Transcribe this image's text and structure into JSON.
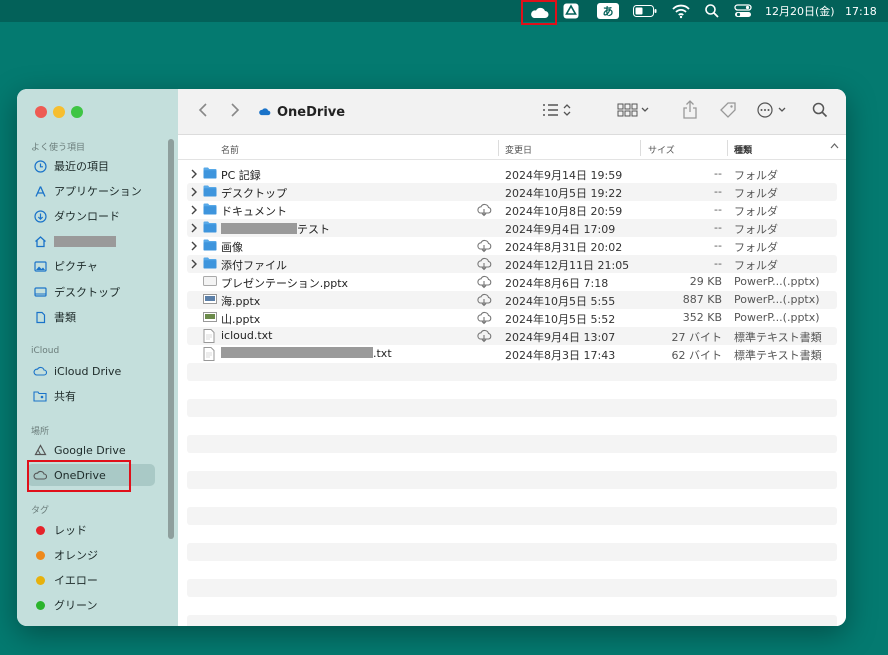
{
  "menubar": {
    "ime_label": "あ",
    "date": "12月20日(金)",
    "time": "17:18"
  },
  "window": {
    "title": "OneDrive",
    "sidebar": {
      "favorites_header": "よく使う項目",
      "favorites": [
        {
          "label": "最近の項目",
          "icon": "clock-icon"
        },
        {
          "label": "アプリケーション",
          "icon": "applications-icon"
        },
        {
          "label": "ダウンロード",
          "icon": "download-icon"
        },
        {
          "label": "",
          "icon": "home-icon",
          "redacted": true
        },
        {
          "label": "ピクチャ",
          "icon": "pictures-icon"
        },
        {
          "label": "デスクトップ",
          "icon": "desktop-icon"
        },
        {
          "label": "書類",
          "icon": "document-icon"
        }
      ],
      "icloud_header": "iCloud",
      "icloud": [
        {
          "label": "iCloud Drive",
          "icon": "icloud-icon"
        },
        {
          "label": "共有",
          "icon": "shared-folder-icon"
        }
      ],
      "locations_header": "場所",
      "locations": [
        {
          "label": "Google Drive",
          "icon": "google-drive-icon"
        },
        {
          "label": "OneDrive",
          "icon": "cloud-icon",
          "selected": true
        }
      ],
      "tags_header": "タグ",
      "tags": [
        {
          "label": "レッド",
          "color": "#e5232a"
        },
        {
          "label": "オレンジ",
          "color": "#ee8a1c"
        },
        {
          "label": "イエロー",
          "color": "#e7b10c"
        },
        {
          "label": "グリーン",
          "color": "#2bb42c"
        }
      ]
    },
    "columns": {
      "name": "名前",
      "modified": "変更日",
      "size": "サイズ",
      "kind": "種類"
    },
    "files": [
      {
        "name": "PC 記録",
        "type": "folder",
        "cloud": false,
        "date": "2024年9月14日 19:59",
        "size": "--",
        "kind": "フォルダ"
      },
      {
        "name": "デスクトップ",
        "type": "folder",
        "cloud": false,
        "date": "2024年10月5日 19:22",
        "size": "--",
        "kind": "フォルダ"
      },
      {
        "name": "ドキュメント",
        "type": "folder",
        "cloud": true,
        "date": "2024年10月8日 20:59",
        "size": "--",
        "kind": "フォルダ"
      },
      {
        "name": "テスト",
        "type": "folder",
        "cloud": false,
        "redacted_prefix": true,
        "date": "2024年9月4日 17:09",
        "size": "--",
        "kind": "フォルダ"
      },
      {
        "name": "画像",
        "type": "folder",
        "cloud": true,
        "date": "2024年8月31日 20:02",
        "size": "--",
        "kind": "フォルダ"
      },
      {
        "name": "添付ファイル",
        "type": "folder",
        "cloud": true,
        "date": "2024年12月11日 21:05",
        "size": "--",
        "kind": "フォルダ"
      },
      {
        "name": "プレゼンテーション.pptx",
        "type": "pptx",
        "cloud": true,
        "date": "2024年8月6日 7:18",
        "size": "29 KB",
        "kind": "PowerP...(.pptx)"
      },
      {
        "name": "海.pptx",
        "type": "pptx-thumb",
        "cloud": true,
        "date": "2024年10月5日 5:55",
        "size": "887 KB",
        "kind": "PowerP...(.pptx)"
      },
      {
        "name": "山.pptx",
        "type": "pptx-thumb2",
        "cloud": true,
        "date": "2024年10月5日 5:52",
        "size": "352 KB",
        "kind": "PowerP...(.pptx)"
      },
      {
        "name": "icloud.txt",
        "type": "txt",
        "cloud": true,
        "date": "2024年9月4日 13:07",
        "size": "27 バイト",
        "kind": "標準テキスト書類"
      },
      {
        "name": ".txt",
        "type": "txt",
        "cloud": false,
        "redacted_prefix_long": true,
        "date": "2024年8月3日 17:43",
        "size": "62 バイト",
        "kind": "標準テキスト書類"
      }
    ],
    "empty_rows": 15
  }
}
